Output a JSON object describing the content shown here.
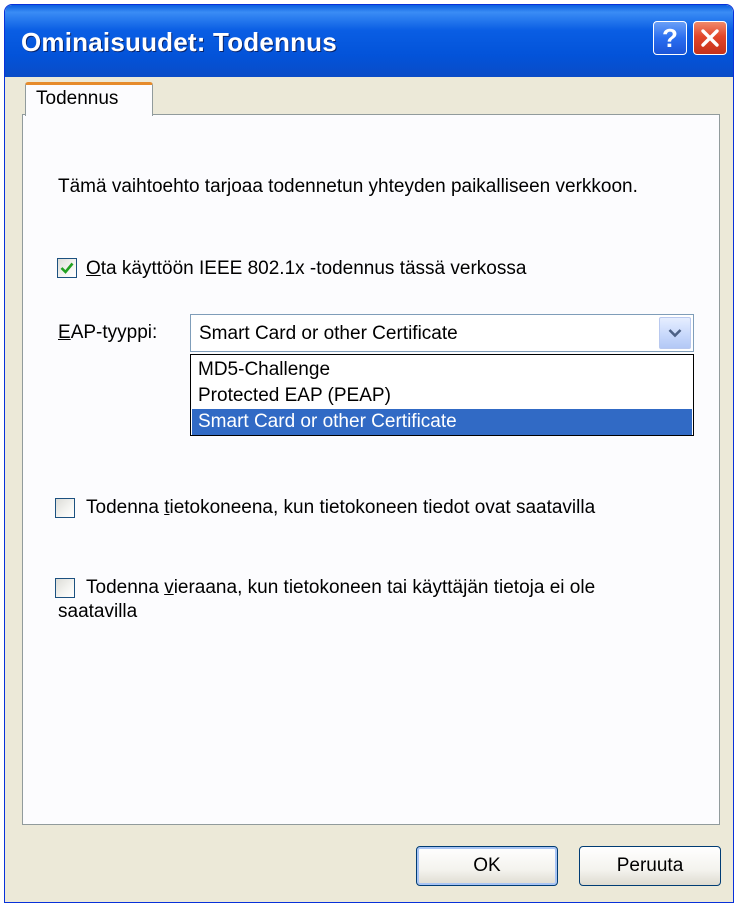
{
  "window": {
    "title": "Ominaisuudet: Todennus"
  },
  "titlebar_buttons": {
    "help_symbol": "?",
    "close_icon": "close-icon"
  },
  "tabs": [
    {
      "label": "Todennus"
    }
  ],
  "description": "Tämä vaihtoehto tarjoaa todennetun yhteyden paikalliseen verkkoon.",
  "enable_8021x": {
    "checked": true,
    "label_prefix": "",
    "label_mnemonic": "O",
    "label_rest": "ta käyttöön IEEE 802.1x -todennus tässä verkossa"
  },
  "eap": {
    "label_mnemonic": "E",
    "label_rest": "AP-tyyppi:",
    "selected_value": "Smart Card or other Certificate",
    "options": [
      {
        "label": "MD5-Challenge",
        "selected": false
      },
      {
        "label": "Protected EAP (PEAP)",
        "selected": false
      },
      {
        "label": "Smart Card or other Certificate",
        "selected": true
      }
    ]
  },
  "auth_as_computer": {
    "checked": false,
    "label_prefix": "Todenna ",
    "label_mnemonic": "t",
    "label_rest": "ietokoneena, kun tietokoneen tiedot ovat saatavilla"
  },
  "auth_as_guest": {
    "checked": false,
    "label_prefix": "Todenna ",
    "label_mnemonic": "v",
    "label_rest": "ieraana, kun tietokoneen tai käyttäjän tietoja ei ole saatavilla"
  },
  "buttons": {
    "ok": "OK",
    "cancel": "Peruuta"
  },
  "colors": {
    "titlebar": "#0353d9",
    "selection": "#316ac5",
    "tab_accent": "#e68b2c",
    "checkmark": "#21a121"
  }
}
